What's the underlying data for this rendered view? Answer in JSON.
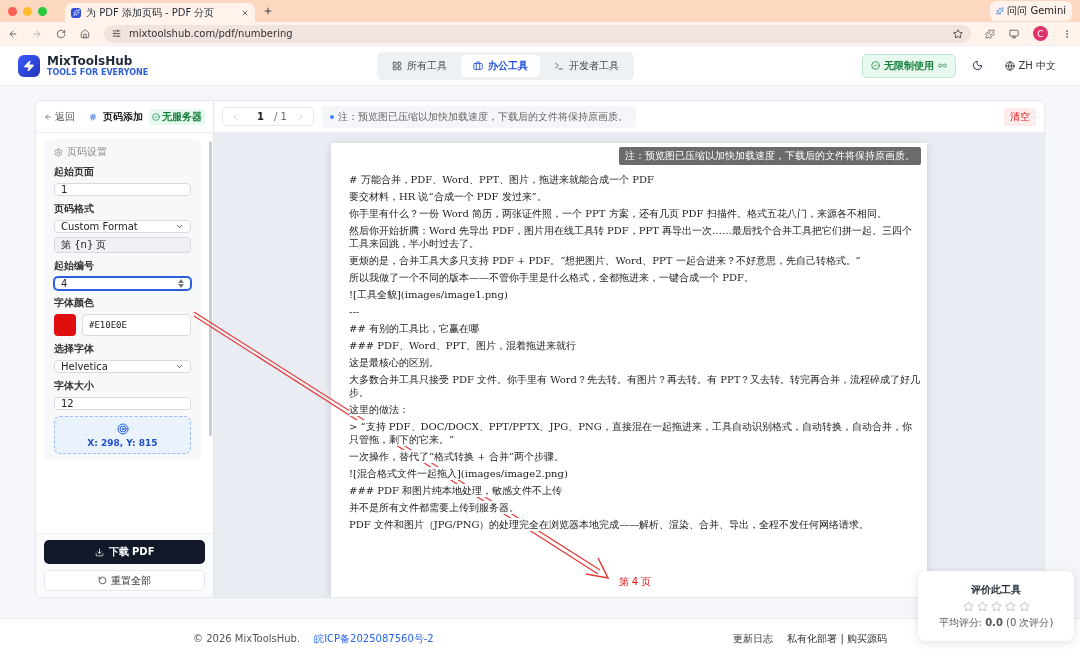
{
  "browser": {
    "tab_title": "为 PDF 添加页码 - PDF 分页",
    "url": "mixtoolshub.com/pdf/numbering",
    "gemini": "问问 Gemini",
    "profile": "C"
  },
  "header": {
    "brand": "MixToolsHub",
    "tagline": "TOOLS FOR EVERYONE",
    "nav": [
      {
        "label": "所有工具",
        "kind": "grid",
        "selected": false
      },
      {
        "label": "办公工具",
        "kind": "briefcase",
        "selected": true
      },
      {
        "label": "开发者工具",
        "kind": "terminal",
        "selected": false
      }
    ],
    "badge": "无限制使用",
    "language": "ZH 中文"
  },
  "sidebar": {
    "back": "返回",
    "title": "页码添加",
    "badge": "无服务器",
    "section": "页码设置",
    "fields": [
      {
        "kind": "input",
        "label": "起始页面",
        "value": "1"
      },
      {
        "kind": "select",
        "label": "页码格式",
        "value": "Custom Format"
      },
      {
        "kind": "readonly",
        "value": "第 {n} 页"
      },
      {
        "kind": "number",
        "label": "起始编号",
        "value": "4"
      },
      {
        "kind": "color",
        "label": "字体颜色",
        "value": "#E10E0E",
        "color": "#e10e0e"
      },
      {
        "kind": "select",
        "label": "选择字体",
        "value": "Helvetica"
      },
      {
        "kind": "input",
        "label": "字体大小",
        "value": "12"
      }
    ],
    "position": "X: 298, Y: 815",
    "download": "下载 PDF",
    "reset": "重置全部"
  },
  "toolbar": {
    "page": "1",
    "total": "/ 1",
    "note": "注：预览图已压缩以加快加载速度，下载后的文件将保持原画质。",
    "clear": "清空"
  },
  "preview": {
    "note": "注：预览图已压缩以加快加载速度，下载后的文件将保持原画质。",
    "paragraphs": [
      "# 万能合并，PDF、Word、PPT、图片，拖进来就能合成一个 PDF",
      "要交材料，HR 说“合成一个 PDF 发过来”。",
      "你手里有什么？一份 Word 简历，两张证件照，一个 PPT 方案，还有几页 PDF 扫描件。格式五花八门，来源各不相同。",
      "然后你开始折腾：Word 先导出 PDF，图片用在线工具转 PDF，PPT 再导出一次……最后找个合并工具把它们拼一起。三四个工具来回跳，半小时过去了。",
      "更烦的是，合并工具大多只支持 PDF + PDF。“想把图片、Word、PPT 一起合进来？不好意思，先自己转格式。”",
      "所以我做了一个不同的版本——不管你手里是什么格式，全都拖进来，一键合成一个 PDF。",
      "![工具全貌](images/image1.png)",
      "---",
      "## 有别的工具比，它赢在哪",
      "### PDF、Word、PPT、图片，混着拖进来就行",
      "这是最核心的区别。",
      "大多数合并工具只接受 PDF 文件。你手里有 Word？先去转。有图片？再去转。有 PPT？又去转。转完再合并，流程碎成了好几步。",
      "这里的做法：",
      "> “支持 PDF、DOC/DOCX、PPT/PPTX、JPG、PNG，直接混在一起拖进来，工具自动识别格式，自动转换，自动合并，你只管拖，剩下的它来。”",
      "一次操作，替代了“格式转换 + 合并”两个步骤。",
      "![混合格式文件一起拖入](images/image2.png)",
      "### PDF 和图片纯本地处理，敏感文件不上传",
      "并不是所有文件都需要上传到服务器。",
      "PDF 文件和图片（JPG/PNG）的处理完全在浏览器本地完成——解析、渲染、合并、导出，全程不发任何网络请求。"
    ],
    "page_number": "第 4 页"
  },
  "footer": {
    "copyright": "© 2026 MixToolsHub.",
    "icp": "皖ICP备2025087560号-2",
    "links": [
      "更新日志",
      "私有化部署 | 购买源码"
    ]
  },
  "rating": {
    "title": "评价此工具",
    "stars": 0,
    "summary": "平均评分: **0.0** (0 次评分)"
  }
}
